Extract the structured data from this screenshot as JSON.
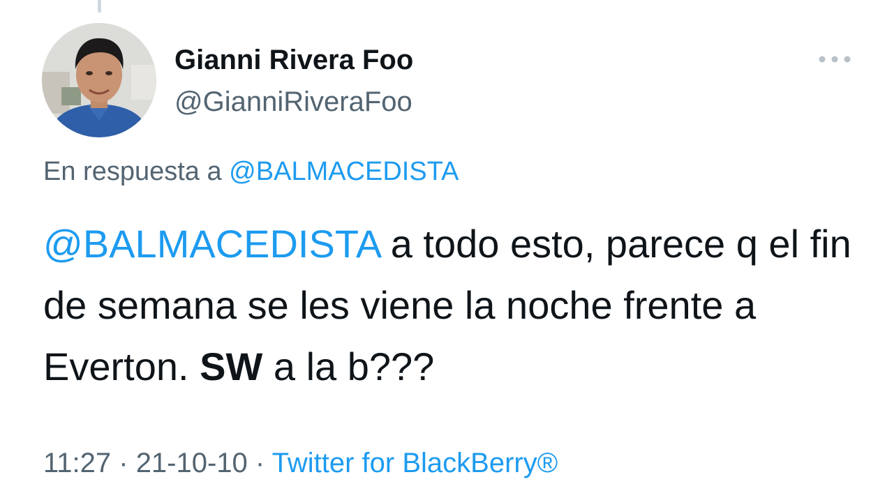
{
  "author": {
    "display_name": "Gianni Rivera Foo",
    "handle": "@GianniRiveraFoo",
    "avatar_icon": "profile-photo"
  },
  "reply": {
    "prefix": "En respuesta a ",
    "mention": "@BALMACEDISTA"
  },
  "tweet": {
    "mention": "@BALMACEDISTA",
    "text_1": " a todo esto, parece q el fin de semana se les viene la noche frente a Everton. ",
    "bold": "SW",
    "text_2": " a la b???"
  },
  "meta": {
    "time": "11:27",
    "sep1": " · ",
    "date": "21-10-10",
    "sep2": " · ",
    "source": "Twitter for BlackBerry®"
  },
  "icons": {
    "more": "more-options-icon"
  },
  "colors": {
    "link": "#1d9bf0",
    "secondary": "#536471",
    "primary": "#0f1419"
  }
}
